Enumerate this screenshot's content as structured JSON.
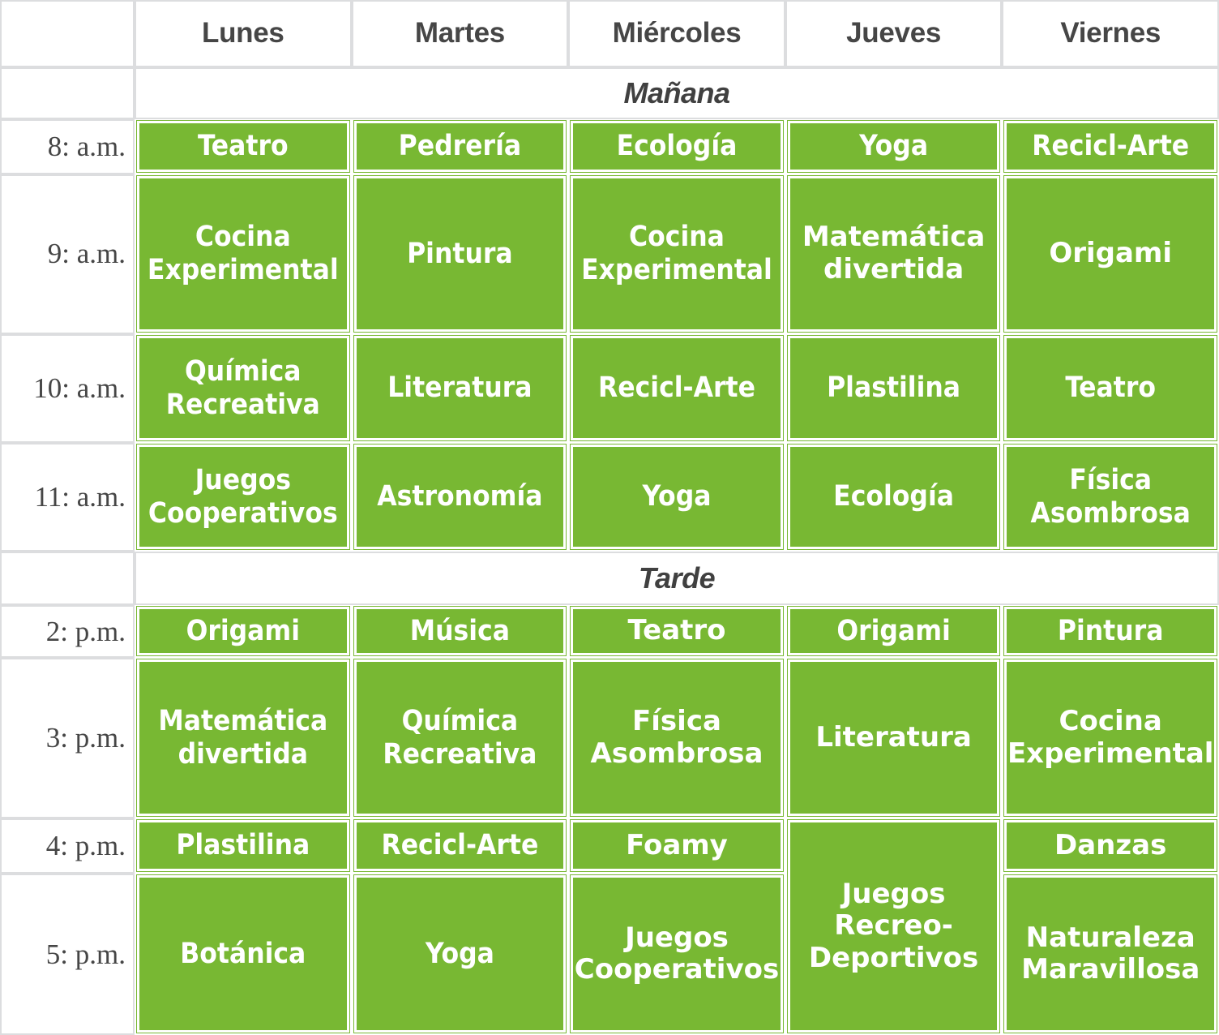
{
  "theme": {
    "accent_green": "#78b833",
    "grid_gray": "#dcdddf",
    "text_gray": "#464646",
    "chip_text": "#ffffff"
  },
  "header": {
    "corner_label": "",
    "days": [
      "Lunes",
      "Martes",
      "Miércoles",
      "Jueves",
      "Viernes"
    ]
  },
  "bands": {
    "morning": "Mañana",
    "afternoon": "Tarde"
  },
  "times": {
    "t8": "8: a.m.",
    "t9": "9: a.m.",
    "t10": "10: a.m.",
    "t11": "11: a.m.",
    "t2": "2: p.m.",
    "t3": "3: p.m.",
    "t4": "4: p.m.",
    "t5": "5: p.m."
  },
  "rows": {
    "r8": {
      "lunes": "Teatro",
      "martes": "Pedrería",
      "miercoles": "Ecología",
      "jueves": "Yoga",
      "viernes": "Recicl-Arte"
    },
    "r9": {
      "lunes": "Cocina Experimental",
      "martes": "Pintura",
      "miercoles": "Cocina Experimental",
      "jueves": "Matemática divertida",
      "viernes": "Origami"
    },
    "r10": {
      "lunes": "Química Recreativa",
      "martes": "Literatura",
      "miercoles": "Recicl-Arte",
      "jueves": "Plastilina",
      "viernes": "Teatro"
    },
    "r11": {
      "lunes": "Juegos Cooperativos",
      "martes": "Astronomía",
      "miercoles": "Yoga",
      "jueves": "Ecología",
      "viernes": "Física Asombrosa"
    },
    "r2": {
      "lunes": "Origami",
      "martes": "Música",
      "miercoles": "Teatro",
      "jueves": "Origami",
      "viernes": "Pintura"
    },
    "r3": {
      "lunes": "Matemática divertida",
      "martes": "Química Recreativa",
      "miercoles": "Física Asombrosa",
      "jueves": "Literatura",
      "viernes": "Cocina Experimental"
    },
    "r4": {
      "lunes": "Plastilina",
      "martes": "Recicl-Arte",
      "miercoles": "Foamy",
      "jueves": "Juegos Recreo-Deportivos",
      "viernes": "Danzas"
    },
    "r5": {
      "lunes": "Botánica",
      "martes": "Yoga",
      "miercoles": "Juegos Cooperativos",
      "viernes": "Naturaleza Maravillosa"
    }
  }
}
